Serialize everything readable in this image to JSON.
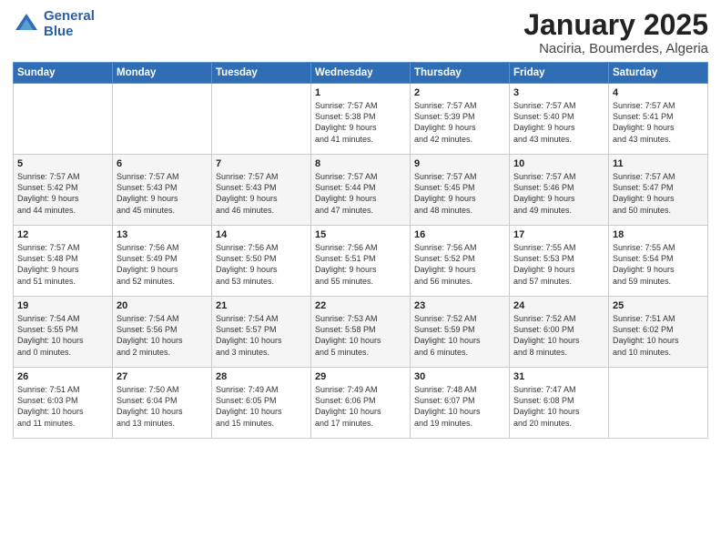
{
  "header": {
    "logo_line1": "General",
    "logo_line2": "Blue",
    "month": "January 2025",
    "location": "Naciria, Boumerdes, Algeria"
  },
  "weekdays": [
    "Sunday",
    "Monday",
    "Tuesday",
    "Wednesday",
    "Thursday",
    "Friday",
    "Saturday"
  ],
  "weeks": [
    [
      {
        "day": "",
        "text": ""
      },
      {
        "day": "",
        "text": ""
      },
      {
        "day": "",
        "text": ""
      },
      {
        "day": "1",
        "text": "Sunrise: 7:57 AM\nSunset: 5:38 PM\nDaylight: 9 hours\nand 41 minutes."
      },
      {
        "day": "2",
        "text": "Sunrise: 7:57 AM\nSunset: 5:39 PM\nDaylight: 9 hours\nand 42 minutes."
      },
      {
        "day": "3",
        "text": "Sunrise: 7:57 AM\nSunset: 5:40 PM\nDaylight: 9 hours\nand 43 minutes."
      },
      {
        "day": "4",
        "text": "Sunrise: 7:57 AM\nSunset: 5:41 PM\nDaylight: 9 hours\nand 43 minutes."
      }
    ],
    [
      {
        "day": "5",
        "text": "Sunrise: 7:57 AM\nSunset: 5:42 PM\nDaylight: 9 hours\nand 44 minutes."
      },
      {
        "day": "6",
        "text": "Sunrise: 7:57 AM\nSunset: 5:43 PM\nDaylight: 9 hours\nand 45 minutes."
      },
      {
        "day": "7",
        "text": "Sunrise: 7:57 AM\nSunset: 5:43 PM\nDaylight: 9 hours\nand 46 minutes."
      },
      {
        "day": "8",
        "text": "Sunrise: 7:57 AM\nSunset: 5:44 PM\nDaylight: 9 hours\nand 47 minutes."
      },
      {
        "day": "9",
        "text": "Sunrise: 7:57 AM\nSunset: 5:45 PM\nDaylight: 9 hours\nand 48 minutes."
      },
      {
        "day": "10",
        "text": "Sunrise: 7:57 AM\nSunset: 5:46 PM\nDaylight: 9 hours\nand 49 minutes."
      },
      {
        "day": "11",
        "text": "Sunrise: 7:57 AM\nSunset: 5:47 PM\nDaylight: 9 hours\nand 50 minutes."
      }
    ],
    [
      {
        "day": "12",
        "text": "Sunrise: 7:57 AM\nSunset: 5:48 PM\nDaylight: 9 hours\nand 51 minutes."
      },
      {
        "day": "13",
        "text": "Sunrise: 7:56 AM\nSunset: 5:49 PM\nDaylight: 9 hours\nand 52 minutes."
      },
      {
        "day": "14",
        "text": "Sunrise: 7:56 AM\nSunset: 5:50 PM\nDaylight: 9 hours\nand 53 minutes."
      },
      {
        "day": "15",
        "text": "Sunrise: 7:56 AM\nSunset: 5:51 PM\nDaylight: 9 hours\nand 55 minutes."
      },
      {
        "day": "16",
        "text": "Sunrise: 7:56 AM\nSunset: 5:52 PM\nDaylight: 9 hours\nand 56 minutes."
      },
      {
        "day": "17",
        "text": "Sunrise: 7:55 AM\nSunset: 5:53 PM\nDaylight: 9 hours\nand 57 minutes."
      },
      {
        "day": "18",
        "text": "Sunrise: 7:55 AM\nSunset: 5:54 PM\nDaylight: 9 hours\nand 59 minutes."
      }
    ],
    [
      {
        "day": "19",
        "text": "Sunrise: 7:54 AM\nSunset: 5:55 PM\nDaylight: 10 hours\nand 0 minutes."
      },
      {
        "day": "20",
        "text": "Sunrise: 7:54 AM\nSunset: 5:56 PM\nDaylight: 10 hours\nand 2 minutes."
      },
      {
        "day": "21",
        "text": "Sunrise: 7:54 AM\nSunset: 5:57 PM\nDaylight: 10 hours\nand 3 minutes."
      },
      {
        "day": "22",
        "text": "Sunrise: 7:53 AM\nSunset: 5:58 PM\nDaylight: 10 hours\nand 5 minutes."
      },
      {
        "day": "23",
        "text": "Sunrise: 7:52 AM\nSunset: 5:59 PM\nDaylight: 10 hours\nand 6 minutes."
      },
      {
        "day": "24",
        "text": "Sunrise: 7:52 AM\nSunset: 6:00 PM\nDaylight: 10 hours\nand 8 minutes."
      },
      {
        "day": "25",
        "text": "Sunrise: 7:51 AM\nSunset: 6:02 PM\nDaylight: 10 hours\nand 10 minutes."
      }
    ],
    [
      {
        "day": "26",
        "text": "Sunrise: 7:51 AM\nSunset: 6:03 PM\nDaylight: 10 hours\nand 11 minutes."
      },
      {
        "day": "27",
        "text": "Sunrise: 7:50 AM\nSunset: 6:04 PM\nDaylight: 10 hours\nand 13 minutes."
      },
      {
        "day": "28",
        "text": "Sunrise: 7:49 AM\nSunset: 6:05 PM\nDaylight: 10 hours\nand 15 minutes."
      },
      {
        "day": "29",
        "text": "Sunrise: 7:49 AM\nSunset: 6:06 PM\nDaylight: 10 hours\nand 17 minutes."
      },
      {
        "day": "30",
        "text": "Sunrise: 7:48 AM\nSunset: 6:07 PM\nDaylight: 10 hours\nand 19 minutes."
      },
      {
        "day": "31",
        "text": "Sunrise: 7:47 AM\nSunset: 6:08 PM\nDaylight: 10 hours\nand 20 minutes."
      },
      {
        "day": "",
        "text": ""
      }
    ]
  ]
}
